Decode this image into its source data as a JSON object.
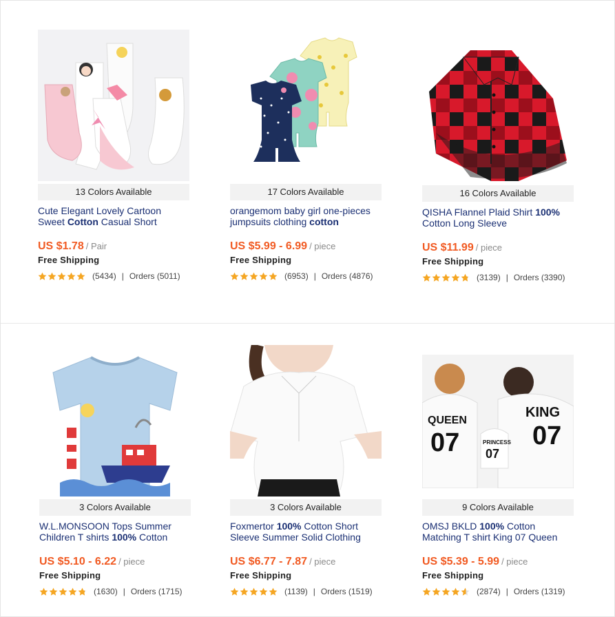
{
  "products": [
    {
      "colors_available": "13 Colors Available",
      "title_parts": [
        "Cute Elegant Lovely Cartoon Sweet ",
        "Cotton",
        " Casual Short"
      ],
      "price": "US $1.78",
      "unit": "/ Pair",
      "shipping": "Free Shipping",
      "rating": 5,
      "reviews": "(5434)",
      "orders": "Orders (5011)",
      "image_label": "cartoon-socks-photo"
    },
    {
      "colors_available": "17 Colors Available",
      "title_parts": [
        "orangemom baby girl one-pieces jumpsuits clothing ",
        "cotton",
        ""
      ],
      "price": "US $5.99 - 6.99",
      "unit": "/ piece",
      "shipping": "Free Shipping",
      "rating": 5,
      "reviews": "(6953)",
      "orders": "Orders (4876)",
      "image_label": "baby-rompers-photo"
    },
    {
      "colors_available": "16 Colors Available",
      "title_parts": [
        "QISHA Flannel Plaid Shirt ",
        "100%",
        " Cotton Long Sleeve"
      ],
      "price": "US $11.99",
      "unit": "/ piece",
      "shipping": "Free Shipping",
      "rating": 4.8,
      "reviews": "(3139)",
      "orders": "Orders (3390)",
      "image_label": "plaid-shirt-photo"
    },
    {
      "colors_available": "3 Colors Available",
      "title_parts": [
        "W.L.MONSOON Tops Summer Children T shirts ",
        "100%",
        " Cotton"
      ],
      "price": "US $5.10 - 6.22",
      "unit": "/ piece",
      "shipping": "Free Shipping",
      "rating": 4.8,
      "reviews": "(1630)",
      "orders": "Orders (1715)",
      "image_label": "kids-tshirt-photo"
    },
    {
      "colors_available": "3 Colors Available",
      "title_parts": [
        "Foxmertor ",
        "100%",
        " Cotton Short Sleeve Summer Solid Clothing"
      ],
      "price": "US $6.77 - 7.87",
      "unit": "/ piece",
      "shipping": "Free Shipping",
      "rating": 5,
      "reviews": "(1139)",
      "orders": "Orders (1519)",
      "image_label": "white-blouse-photo"
    },
    {
      "colors_available": "9 Colors Available",
      "title_parts": [
        "OMSJ BKLD ",
        "100%",
        " Cotton Matching T shirt King 07 Queen"
      ],
      "price": "US $5.39 - 5.99",
      "unit": "/ piece",
      "shipping": "Free Shipping",
      "rating": 4.6,
      "reviews": "(2874)",
      "orders": "Orders (1319)",
      "image_label": "family-tshirts-photo"
    }
  ],
  "family_shirt_prints": {
    "queen": "QUEEN",
    "princess": "PRINCESS",
    "king": "KING",
    "number": "07"
  },
  "colors": {
    "price": "#f15a22",
    "title": "#1a2f73",
    "star": "#f5a623",
    "label_bg": "#f2f2f2"
  }
}
